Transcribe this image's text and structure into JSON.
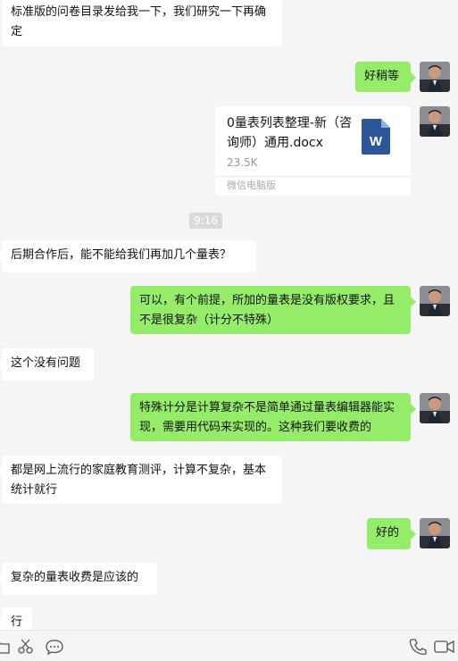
{
  "messages": [
    {
      "side": "in",
      "text": "标准版的问卷目录发给我一下，我们研究一下再确定"
    },
    {
      "side": "out",
      "text": "好稍等"
    },
    {
      "side": "out",
      "type": "file",
      "file_name": "0量表列表整理-新（咨询师）通用.docx",
      "file_size": "23.5K",
      "file_source": "微信电脑版"
    },
    {
      "type": "time",
      "text": "9:16"
    },
    {
      "side": "in",
      "text": "后期合作后，能不能给我们再加几个量表？"
    },
    {
      "side": "out",
      "text": "可以，有个前提，所加的量表是没有版权要求，且不是很复杂（计分不特殊）"
    },
    {
      "side": "in",
      "text": "这个没有问题"
    },
    {
      "side": "out",
      "text": "特殊计分是计算复杂不是简单通过量表编辑器能实现，需要用代码来实现的。这种我们要收费的"
    },
    {
      "side": "in",
      "text": "都是网上流行的家庭教育测评，计算不复杂，基本统计就行"
    },
    {
      "side": "out",
      "text": "好的"
    },
    {
      "side": "in",
      "text": "复杂的量表收费是应该的"
    },
    {
      "side": "in",
      "text": "行"
    }
  ],
  "toolbar": {
    "left_icons": [
      "folder-icon",
      "scissors-icon",
      "chat-bubble-icon"
    ],
    "right_icons": [
      "phone-icon",
      "video-icon"
    ]
  },
  "colors": {
    "background": "#f5f5f5",
    "incoming_bubble": "#ffffff",
    "outgoing_bubble": "#95ec69",
    "word_blue": "#2b579a"
  }
}
